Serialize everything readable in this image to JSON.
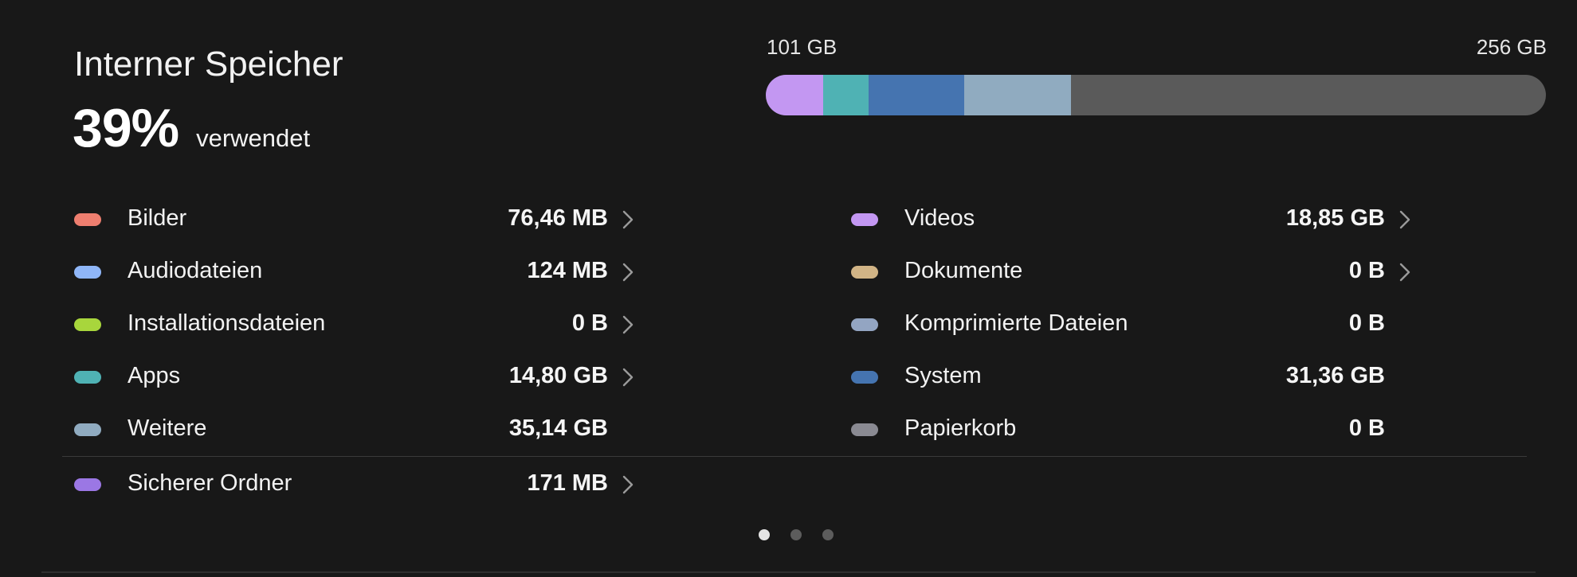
{
  "header": {
    "title": "Interner Speicher",
    "percent": "39%",
    "percent_label": "verwendet"
  },
  "bar": {
    "used_label": "101 GB",
    "total_label": "256 GB",
    "track_color": "#5a5a5a",
    "segments": [
      {
        "category": "Videos",
        "fraction": 0.0736,
        "color": "#c397f2"
      },
      {
        "category": "Apps",
        "fraction": 0.0578,
        "color": "#4fb2b4"
      },
      {
        "category": "System",
        "fraction": 0.1225,
        "color": "#4574b0"
      },
      {
        "category": "Weitere",
        "fraction": 0.1373,
        "color": "#90abc0"
      }
    ]
  },
  "categories_left": [
    {
      "label": "Bilder",
      "size": "76,46 MB",
      "color": "#ee7e6f",
      "chevron": true
    },
    {
      "label": "Audiodateien",
      "size": "124 MB",
      "color": "#8fb6f8",
      "chevron": true
    },
    {
      "label": "Installationsdateien",
      "size": "0 B",
      "color": "#a8d63c",
      "chevron": true
    },
    {
      "label": "Apps",
      "size": "14,80 GB",
      "color": "#4fb2b4",
      "chevron": true
    },
    {
      "label": "Weitere",
      "size": "35,14 GB",
      "color": "#90abc0",
      "chevron": false
    }
  ],
  "categories_right": [
    {
      "label": "Videos",
      "size": "18,85 GB",
      "color": "#c397f2",
      "chevron": true
    },
    {
      "label": "Dokumente",
      "size": "0 B",
      "color": "#d1b486",
      "chevron": true
    },
    {
      "label": "Komprimierte Dateien",
      "size": "0 B",
      "color": "#93a5c2",
      "chevron": false
    },
    {
      "label": "System",
      "size": "31,36 GB",
      "color": "#4574b0",
      "chevron": false
    },
    {
      "label": "Papierkorb",
      "size": "0 B",
      "color": "#8a8a92",
      "chevron": false
    }
  ],
  "secure_folder": {
    "label": "Sicherer Ordner",
    "size": "171 MB",
    "color": "#9b77e4",
    "chevron": true
  },
  "pager": {
    "count": 3,
    "active": 0
  },
  "icons": {
    "chevron": "chevron-right-icon"
  }
}
